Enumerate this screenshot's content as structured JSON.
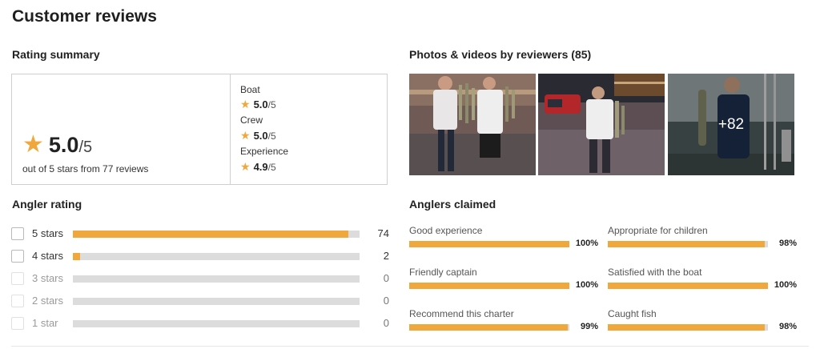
{
  "page_title": "Customer reviews",
  "rating_summary": {
    "heading": "Rating summary",
    "overall_score": "5.0",
    "overall_out_of": "/5",
    "overall_subtext": "out of 5 stars from 77 reviews",
    "categories": [
      {
        "label": "Boat",
        "score": "5.0",
        "out_of": "/5"
      },
      {
        "label": "Crew",
        "score": "5.0",
        "out_of": "/5"
      },
      {
        "label": "Experience",
        "score": "4.9",
        "out_of": "/5"
      }
    ]
  },
  "angler_rating": {
    "heading": "Angler rating",
    "rows": [
      {
        "label": "5 stars",
        "count": "74",
        "fraction": 0.961,
        "enabled": true
      },
      {
        "label": "4 stars",
        "count": "2",
        "fraction": 0.026,
        "enabled": true
      },
      {
        "label": "3 stars",
        "count": "0",
        "fraction": 0,
        "enabled": false
      },
      {
        "label": "2 stars",
        "count": "0",
        "fraction": 0,
        "enabled": false
      },
      {
        "label": "1 star",
        "count": "0",
        "fraction": 0,
        "enabled": false
      }
    ]
  },
  "photos": {
    "heading": "Photos & videos by reviewers (85)",
    "more_label": "+82"
  },
  "anglers_claimed": {
    "heading": "Anglers claimed",
    "items": [
      {
        "label": "Good experience",
        "percent": "100%",
        "fraction": 1.0
      },
      {
        "label": "Appropriate for children",
        "percent": "98%",
        "fraction": 0.98
      },
      {
        "label": "Friendly captain",
        "percent": "100%",
        "fraction": 1.0
      },
      {
        "label": "Satisfied with the boat",
        "percent": "100%",
        "fraction": 1.0
      },
      {
        "label": "Recommend this charter",
        "percent": "99%",
        "fraction": 0.99
      },
      {
        "label": "Caught fish",
        "percent": "98%",
        "fraction": 0.98
      }
    ]
  },
  "colors": {
    "accent": "#f0a83c",
    "track": "#dcdcdc"
  }
}
